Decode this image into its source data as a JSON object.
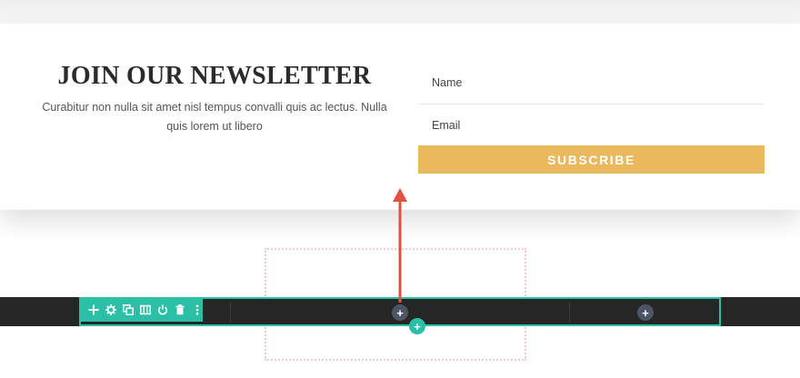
{
  "newsletter": {
    "title": "JOIN OUR NEWSLETTER",
    "body": "Curabitur non nulla sit amet nisl tempus convalli quis ac lectus. Nulla quis lorem ut libero"
  },
  "form": {
    "name_placeholder": "Name",
    "email_placeholder": "Email",
    "subscribe_label": "SUBSCRIBE"
  },
  "builder": {
    "add_symbol": "+",
    "toolbar_icons": [
      "move-icon",
      "gear-icon",
      "duplicate-icon",
      "columns-icon",
      "power-icon",
      "trash-icon",
      "more-icon"
    ]
  },
  "colors": {
    "accent_teal": "#2bbfa8",
    "button_yellow": "#ebb95d",
    "section_dark": "#262626",
    "arrow_red": "#e4503f"
  }
}
